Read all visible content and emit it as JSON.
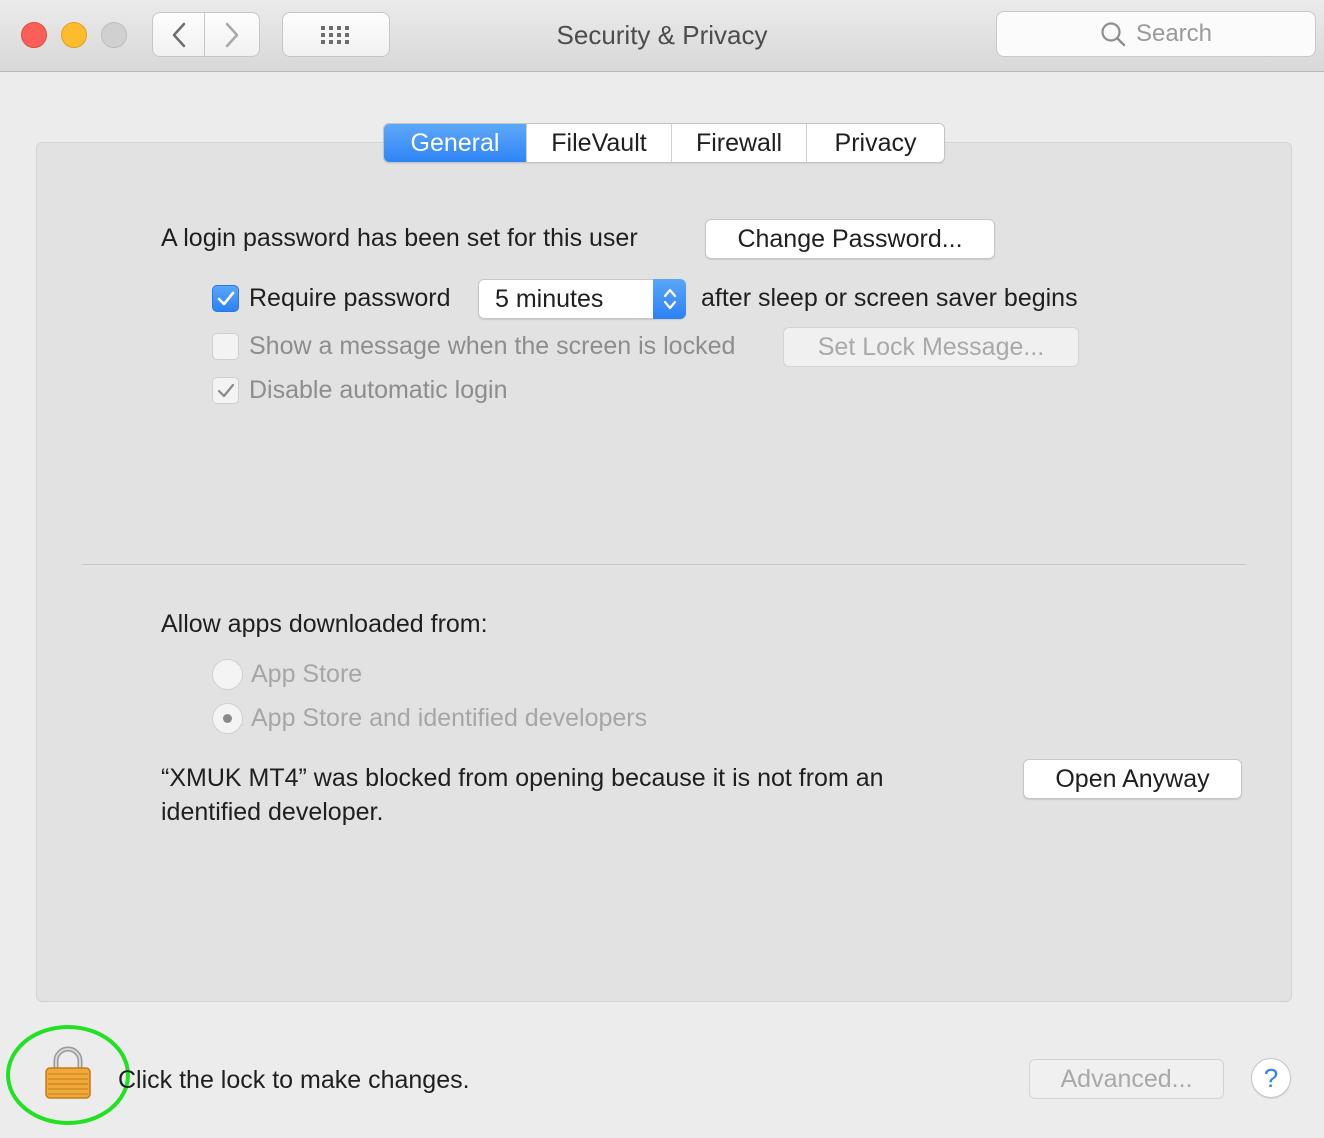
{
  "window": {
    "title": "Security & Privacy",
    "search_placeholder": "Search"
  },
  "tabs": [
    {
      "label": "General",
      "active": true
    },
    {
      "label": "FileVault",
      "active": false
    },
    {
      "label": "Firewall",
      "active": false
    },
    {
      "label": "Privacy",
      "active": false
    }
  ],
  "general": {
    "login_password_text": "A login password has been set for this user",
    "change_password_label": "Change Password...",
    "require_password": {
      "label": "Require password",
      "checked": true
    },
    "require_password_delay": "5 minutes",
    "require_password_suffix": "after sleep or screen saver begins",
    "show_message": {
      "label": "Show a message when the screen is locked",
      "checked": false
    },
    "set_lock_message_label": "Set Lock Message...",
    "disable_auto_login": {
      "label": "Disable automatic login",
      "checked": true
    }
  },
  "gatekeeper": {
    "heading": "Allow apps downloaded from:",
    "options": [
      {
        "label": "App Store",
        "selected": false
      },
      {
        "label": "App Store and identified developers",
        "selected": true
      }
    ],
    "blocked_line1": "“XMUK MT4” was blocked from opening because it is not from an",
    "blocked_line2": "identified developer.",
    "open_anyway_label": "Open Anyway"
  },
  "footer": {
    "lock_text": "Click the lock to make changes.",
    "advanced_label": "Advanced...",
    "help_label": "?"
  },
  "colors": {
    "accent": "#2f85f6",
    "highlight_circle": "#22e022"
  }
}
